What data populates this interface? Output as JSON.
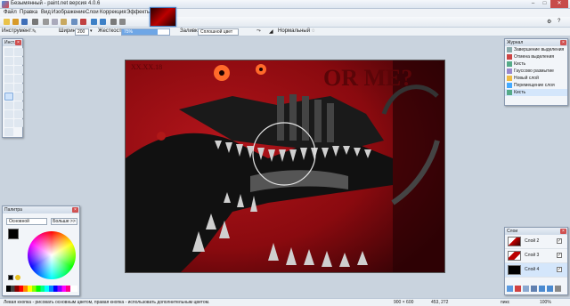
{
  "window": {
    "title": "Безымянный - paint.net версия 4.0.6",
    "buttons": [
      "–",
      "□",
      "✕"
    ]
  },
  "menu": {
    "items": [
      "Файл",
      "Правка",
      "Вид",
      "Изображение",
      "Слои",
      "Коррекция",
      "Эффекты"
    ]
  },
  "toolbar": {
    "help": "?",
    "settings": "⚙"
  },
  "tool_options": {
    "tool_label": "Инструмент:",
    "width_label": "Ширина:",
    "width_value": "200",
    "hardness_label": "Жесткость:",
    "hardness_value": "75%",
    "hardness_fraction": 0.75,
    "fill_label": "Заливка:",
    "fill_value": "Сплошной цвет",
    "blend_value": "Нормальный"
  },
  "tools_panel": {
    "title": "Инст..."
  },
  "history_panel": {
    "title": "Журнал",
    "items": [
      "Завершение выделения",
      "Отмена выделения",
      "Кисть",
      "Гауссово размытие",
      "Новый слой",
      "Перемещение слоя",
      "Кисть"
    ],
    "selected_index": 6
  },
  "palette_panel": {
    "title": "Палитра",
    "mode": "Основной",
    "more_button": "Больше >>"
  },
  "layers_panel": {
    "title": "Слои",
    "layers": [
      {
        "name": "Слой 2",
        "checked": true
      },
      {
        "name": "Слой 3",
        "checked": true
      },
      {
        "name": "Слой 4",
        "checked": true
      }
    ]
  },
  "canvas_art": {
    "text_date": "XX.XX.18",
    "text_big": "OR ME?"
  },
  "status": {
    "hint": "Левая кнопка - рисовать основным цветом, правая кнопка - использовать дополнительным цветом.",
    "size": "900 × 600",
    "pos": "453, 272",
    "units": "пикс",
    "zoom": "100%"
  },
  "colors": {
    "accent": "#3b78c9",
    "canvas_red": "#a10f14",
    "dark_red": "#5a0508"
  }
}
